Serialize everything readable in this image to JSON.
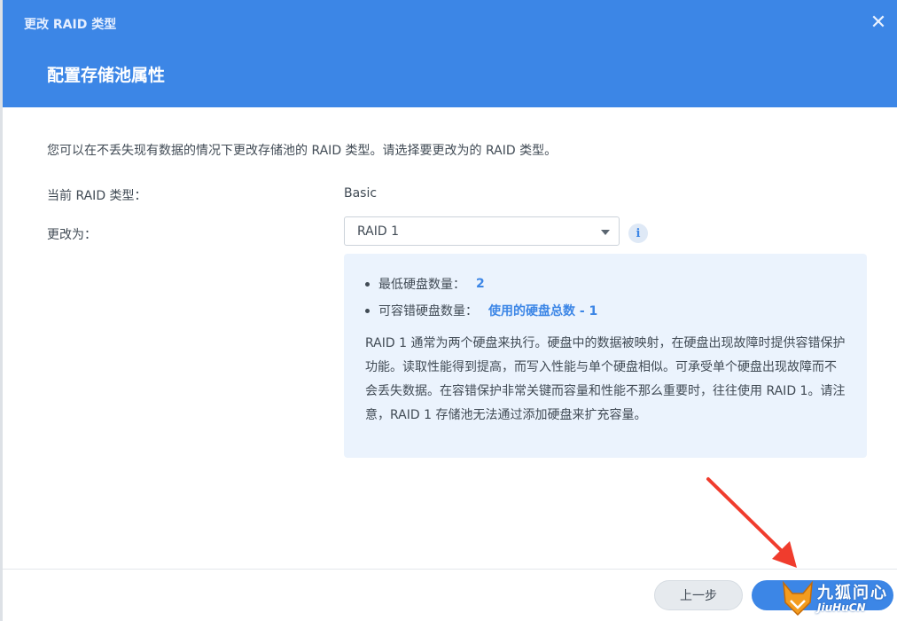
{
  "window": {
    "title": "更改 RAID 类型"
  },
  "header": {
    "step_title": "配置存储池属性"
  },
  "description": "您可以在不丢失现有数据的情况下更改存储池的 RAID 类型。请选择要更改为的 RAID 类型。",
  "form": {
    "current_label": "当前 RAID 类型：",
    "current_value": "Basic",
    "change_label": "更改为：",
    "selected_raid": "RAID 1"
  },
  "info": {
    "min_disks_label": "最低硬盘数量：",
    "min_disks_value": "2",
    "fault_tolerance_label": "可容错硬盘数量：",
    "fault_tolerance_value": "使用的硬盘总数 - 1",
    "paragraph": "RAID 1 通常为两个硬盘来执行。硬盘中的数据被映射，在硬盘出现故障时提供容错保护功能。读取性能得到提高，而写入性能与单个硬盘相似。可承受单个硬盘出现故障而不会丢失数据。在容错保护非常关键而容量和性能不那么重要时，往往使用 RAID 1。请注意，RAID 1 存储池无法通过添加硬盘来扩充容量。"
  },
  "footer": {
    "prev_label": "上一步"
  },
  "watermark": {
    "text": "九狐问心",
    "sub": "JiuHuCN"
  },
  "colors": {
    "accent": "#3c86e6",
    "info_bg": "#ebf3fd",
    "arrow": "#f03c2d"
  }
}
